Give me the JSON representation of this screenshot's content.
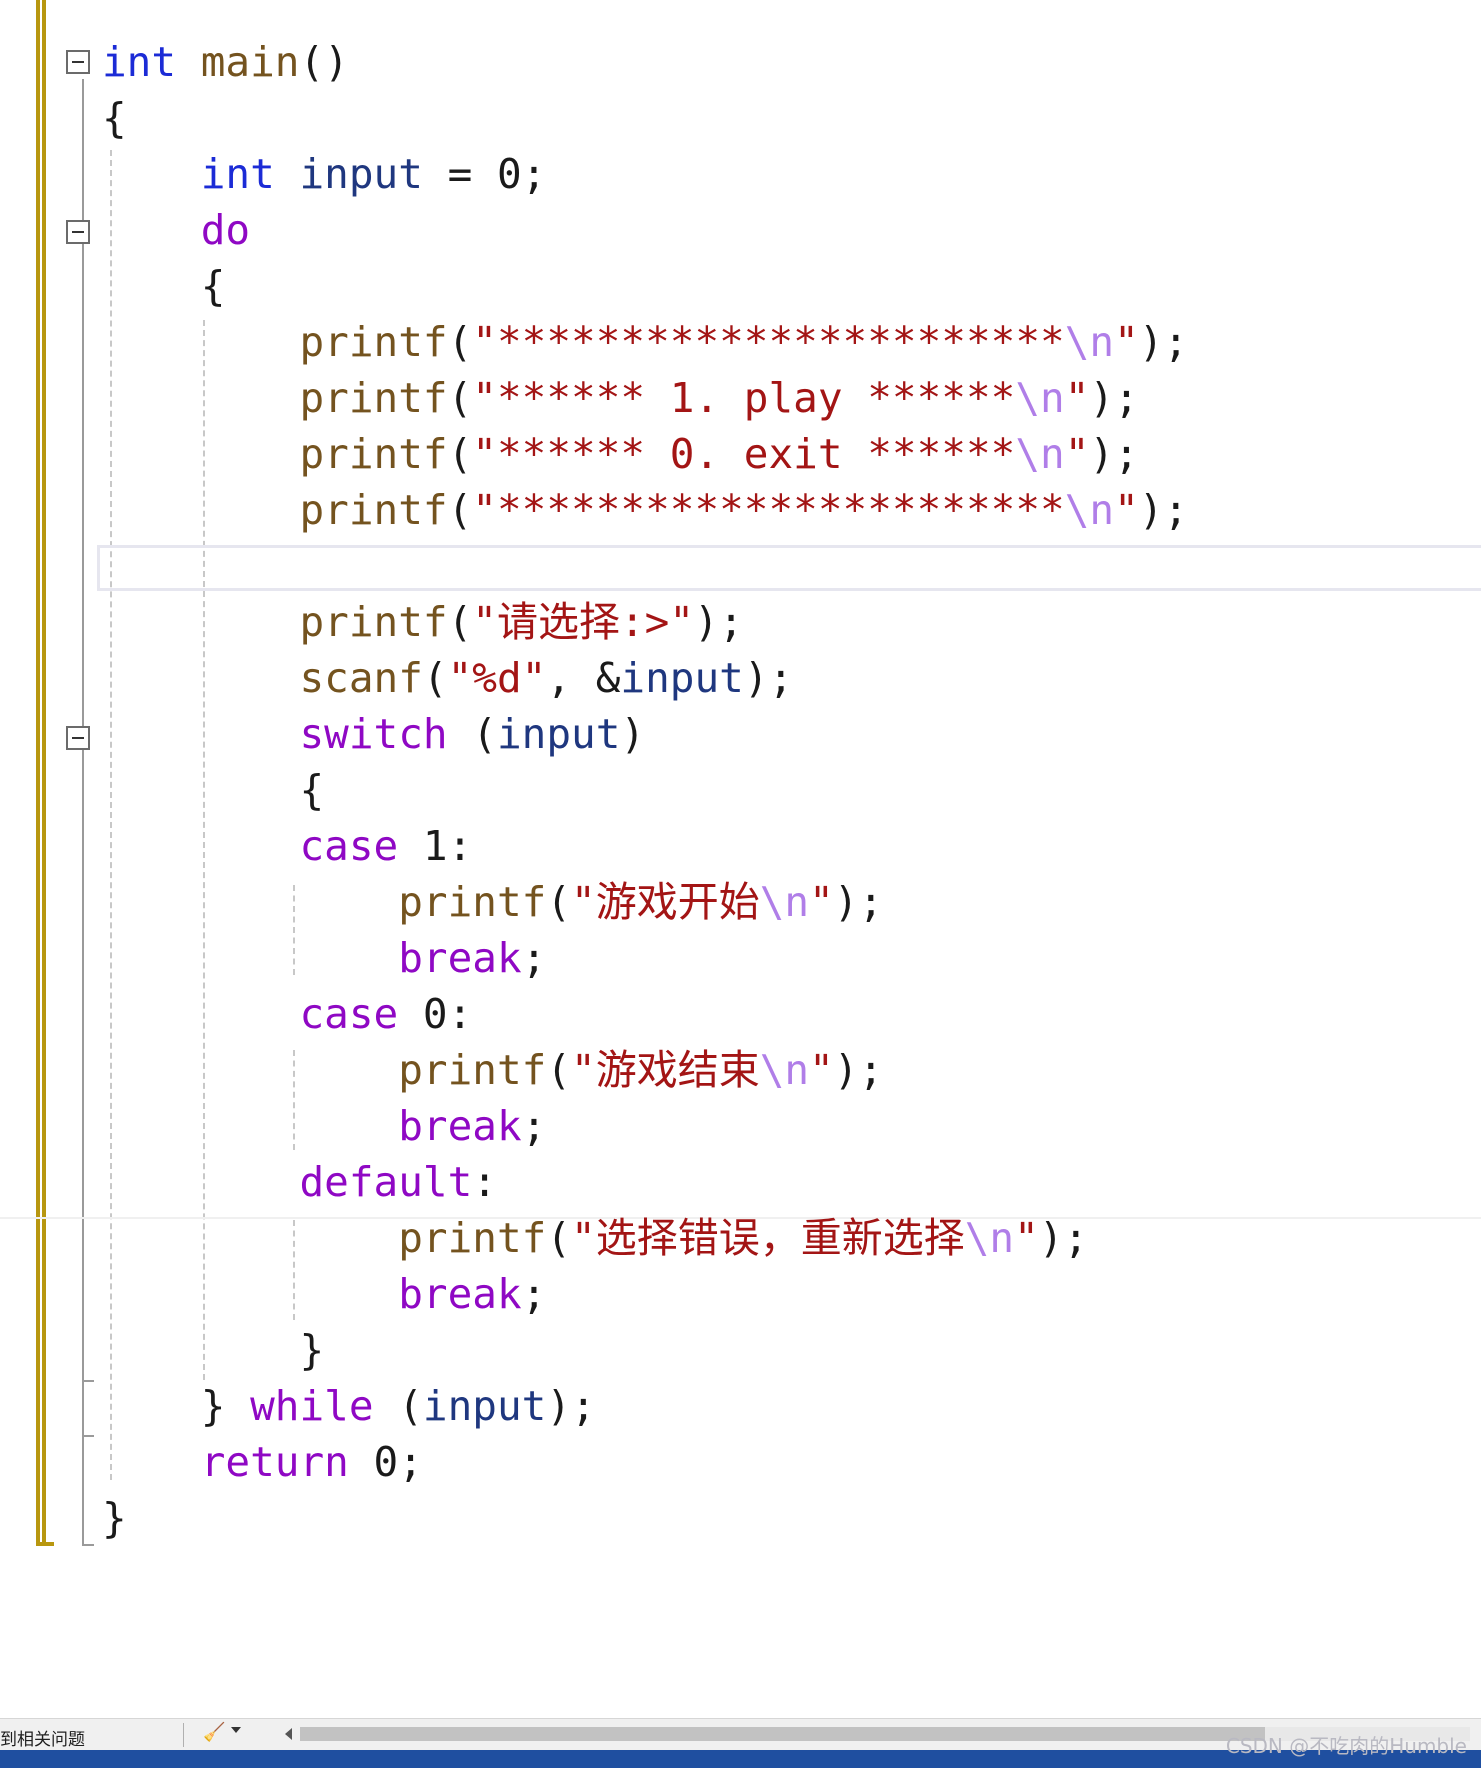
{
  "editor": {
    "lines": [
      [
        {
          "t": "int",
          "c": "kw-blue"
        },
        {
          "t": " "
        },
        {
          "t": "main",
          "c": "fn"
        },
        {
          "t": "()"
        }
      ],
      [
        {
          "t": "{"
        }
      ],
      [
        {
          "t": "    "
        },
        {
          "t": "int",
          "c": "kw-blue"
        },
        {
          "t": " "
        },
        {
          "t": "input",
          "c": "ident"
        },
        {
          "t": " = 0;"
        }
      ],
      [
        {
          "t": "    "
        },
        {
          "t": "do",
          "c": "kw-purple"
        }
      ],
      [
        {
          "t": "    {"
        }
      ],
      [
        {
          "t": "        "
        },
        {
          "t": "printf",
          "c": "fn"
        },
        {
          "t": "("
        },
        {
          "t": "\"***********************",
          "c": "str"
        },
        {
          "t": "\\n",
          "c": "esc"
        },
        {
          "t": "\"",
          "c": "str"
        },
        {
          "t": ");"
        }
      ],
      [
        {
          "t": "        "
        },
        {
          "t": "printf",
          "c": "fn"
        },
        {
          "t": "("
        },
        {
          "t": "\"****** 1. play ******",
          "c": "str"
        },
        {
          "t": "\\n",
          "c": "esc"
        },
        {
          "t": "\"",
          "c": "str"
        },
        {
          "t": ");"
        }
      ],
      [
        {
          "t": "        "
        },
        {
          "t": "printf",
          "c": "fn"
        },
        {
          "t": "("
        },
        {
          "t": "\"****** 0. exit ******",
          "c": "str"
        },
        {
          "t": "\\n",
          "c": "esc"
        },
        {
          "t": "\"",
          "c": "str"
        },
        {
          "t": ");"
        }
      ],
      [
        {
          "t": "        "
        },
        {
          "t": "printf",
          "c": "fn"
        },
        {
          "t": "("
        },
        {
          "t": "\"***********************",
          "c": "str"
        },
        {
          "t": "\\n",
          "c": "esc"
        },
        {
          "t": "\"",
          "c": "str"
        },
        {
          "t": ");"
        }
      ],
      [],
      [
        {
          "t": "        "
        },
        {
          "t": "printf",
          "c": "fn"
        },
        {
          "t": "("
        },
        {
          "t": "\"请选择:>\"",
          "c": "str"
        },
        {
          "t": ");"
        }
      ],
      [
        {
          "t": "        "
        },
        {
          "t": "scanf",
          "c": "fn"
        },
        {
          "t": "("
        },
        {
          "t": "\"%d\"",
          "c": "str"
        },
        {
          "t": ", &"
        },
        {
          "t": "input",
          "c": "ident"
        },
        {
          "t": ");"
        }
      ],
      [
        {
          "t": "        "
        },
        {
          "t": "switch",
          "c": "kw-purple"
        },
        {
          "t": " ("
        },
        {
          "t": "input",
          "c": "ident"
        },
        {
          "t": ")"
        }
      ],
      [
        {
          "t": "        {"
        }
      ],
      [
        {
          "t": "        "
        },
        {
          "t": "case",
          "c": "kw-purple"
        },
        {
          "t": " 1:"
        }
      ],
      [
        {
          "t": "            "
        },
        {
          "t": "printf",
          "c": "fn"
        },
        {
          "t": "("
        },
        {
          "t": "\"游戏开始",
          "c": "str"
        },
        {
          "t": "\\n",
          "c": "esc"
        },
        {
          "t": "\"",
          "c": "str"
        },
        {
          "t": ");"
        }
      ],
      [
        {
          "t": "            "
        },
        {
          "t": "break",
          "c": "kw-purple"
        },
        {
          "t": ";"
        }
      ],
      [
        {
          "t": "        "
        },
        {
          "t": "case",
          "c": "kw-purple"
        },
        {
          "t": " 0:"
        }
      ],
      [
        {
          "t": "            "
        },
        {
          "t": "printf",
          "c": "fn"
        },
        {
          "t": "("
        },
        {
          "t": "\"游戏结束",
          "c": "str"
        },
        {
          "t": "\\n",
          "c": "esc"
        },
        {
          "t": "\"",
          "c": "str"
        },
        {
          "t": ");"
        }
      ],
      [
        {
          "t": "            "
        },
        {
          "t": "break",
          "c": "kw-purple"
        },
        {
          "t": ";"
        }
      ],
      [
        {
          "t": "        "
        },
        {
          "t": "default",
          "c": "kw-purple"
        },
        {
          "t": ":"
        }
      ],
      [
        {
          "t": "            "
        },
        {
          "t": "printf",
          "c": "fn"
        },
        {
          "t": "("
        },
        {
          "t": "\"选择错误，重新选择",
          "c": "str"
        },
        {
          "t": "\\n",
          "c": "esc"
        },
        {
          "t": "\"",
          "c": "str"
        },
        {
          "t": ");"
        }
      ],
      [
        {
          "t": "            "
        },
        {
          "t": "break",
          "c": "kw-purple"
        },
        {
          "t": ";"
        }
      ],
      [
        {
          "t": "        }"
        }
      ],
      [
        {
          "t": "    } "
        },
        {
          "t": "while",
          "c": "kw-purple"
        },
        {
          "t": " ("
        },
        {
          "t": "input",
          "c": "ident"
        },
        {
          "t": ");"
        }
      ],
      [
        {
          "t": "    "
        },
        {
          "t": "return",
          "c": "kw-purple"
        },
        {
          "t": " 0;"
        }
      ],
      [
        {
          "t": "}"
        }
      ]
    ]
  },
  "status_bar": {
    "issues_text": "到相关问题",
    "brush_icon": "code-cleanup-icon",
    "dropdown_icon": "chevron-down-icon",
    "scroll_icon": "scroll-left-icon"
  },
  "watermark": "CSDN @不吃肉的Humble"
}
